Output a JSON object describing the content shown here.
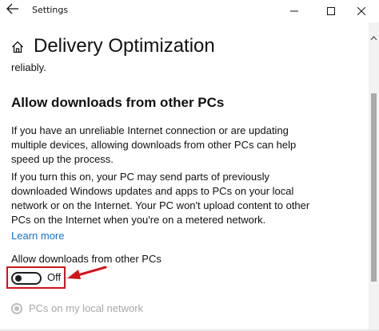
{
  "window": {
    "title": "Settings",
    "controls": [
      "minimize",
      "maximize",
      "close"
    ]
  },
  "page": {
    "title": "Delivery Optimization"
  },
  "content": {
    "truncated_line": "reliably.",
    "section_heading": "Allow downloads from other PCs",
    "paragraph1": [
      "If you have an unreliable Internet connection or are updating",
      "multiple devices, allowing downloads from other PCs can help",
      "speed up the process."
    ],
    "paragraph2": [
      "If you turn this on, your PC may send parts of previously",
      "downloaded Windows updates and apps to PCs on your local",
      "network or on the Internet. Your PC won't upload content to other",
      "PCs on the Internet when you're on a metered network."
    ],
    "learn_more": "Learn more"
  },
  "toggle": {
    "label": "Allow downloads from other PCs",
    "state": "Off",
    "on": false
  },
  "radio": {
    "label": "PCs on my local network",
    "selected": true,
    "disabled": true
  },
  "colors": {
    "link": "#1a6fc4",
    "highlight": "#d0141b",
    "disabled": "#a8a8a8"
  },
  "icons": {
    "back": "back-arrow-icon",
    "home": "home-icon",
    "annotation": "red-arrow-icon"
  }
}
